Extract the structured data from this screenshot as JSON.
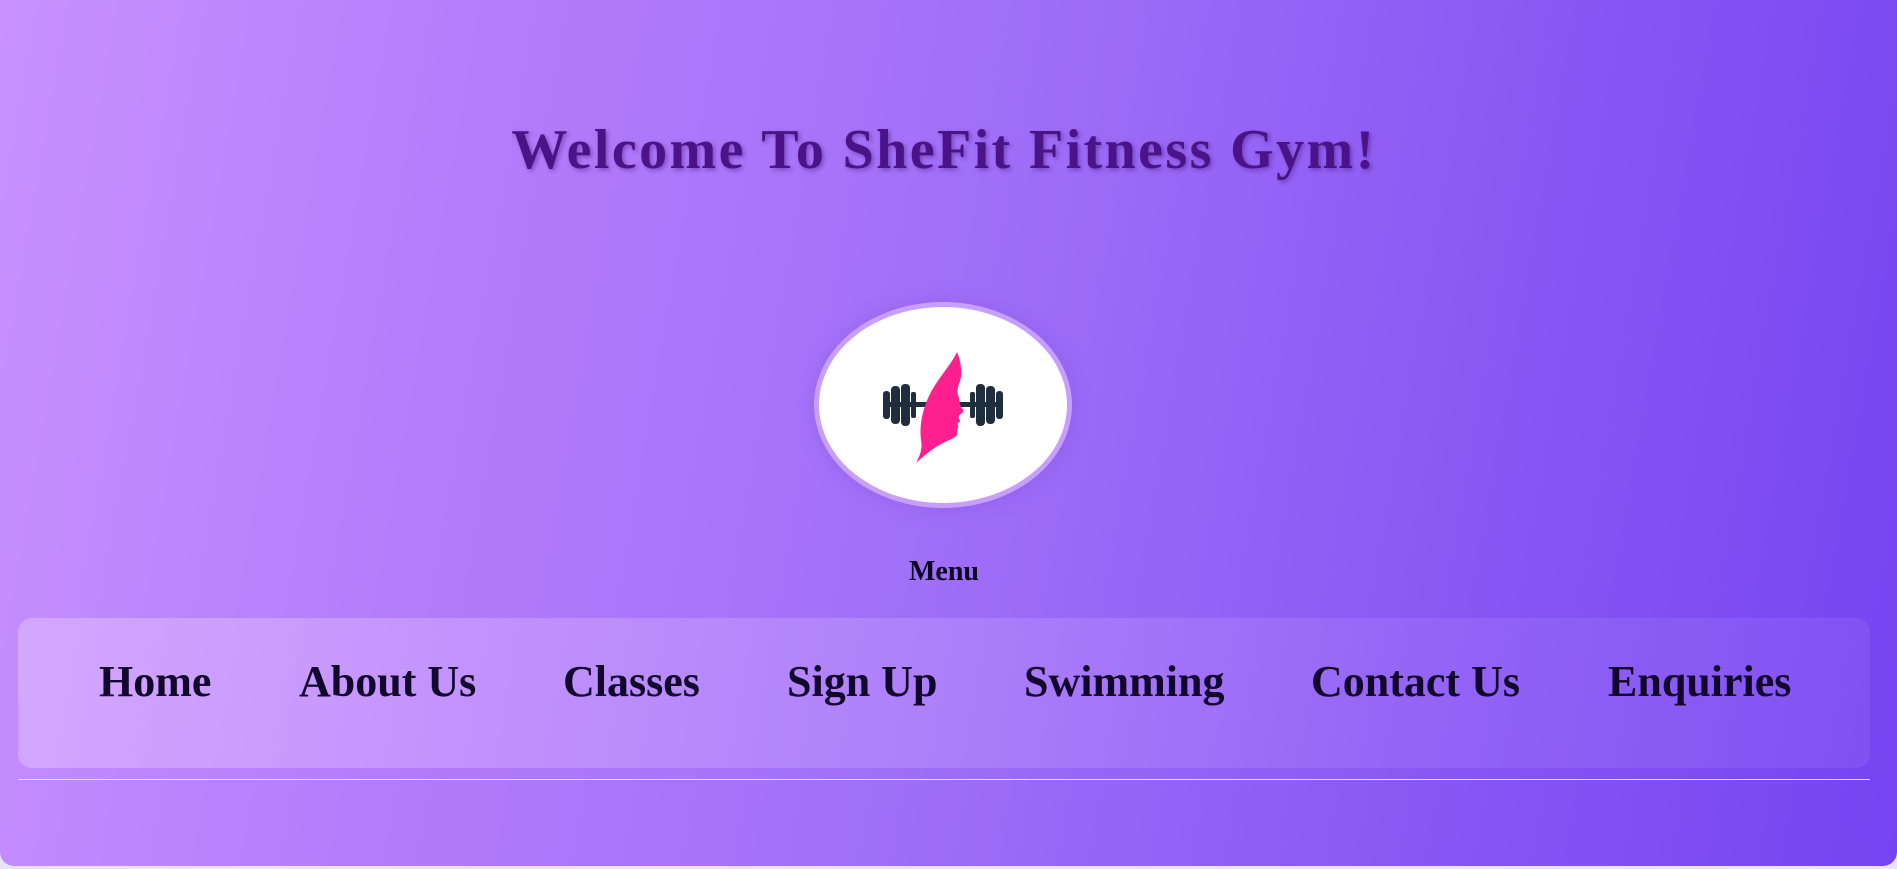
{
  "header": {
    "title": "Welcome To SheFit Fitness Gym!"
  },
  "logo": {
    "icon": "woman-profile-dumbbell-icon",
    "colors": {
      "dumbbell": "#1f2d3d",
      "woman": "#ff1f8e",
      "ring": "#c7a0ff",
      "background": "#ffffff"
    }
  },
  "menu": {
    "label": "Menu",
    "items": [
      {
        "label": "Home"
      },
      {
        "label": "About Us"
      },
      {
        "label": "Classes"
      },
      {
        "label": "Sign Up"
      },
      {
        "label": "Swimming"
      },
      {
        "label": "Contact Us"
      },
      {
        "label": "Enquiries"
      }
    ]
  },
  "theme": {
    "gradient_start": "#c891ff",
    "gradient_end": "#7544f1",
    "title_color": "#4a1488",
    "nav_text_color": "#12062c"
  }
}
